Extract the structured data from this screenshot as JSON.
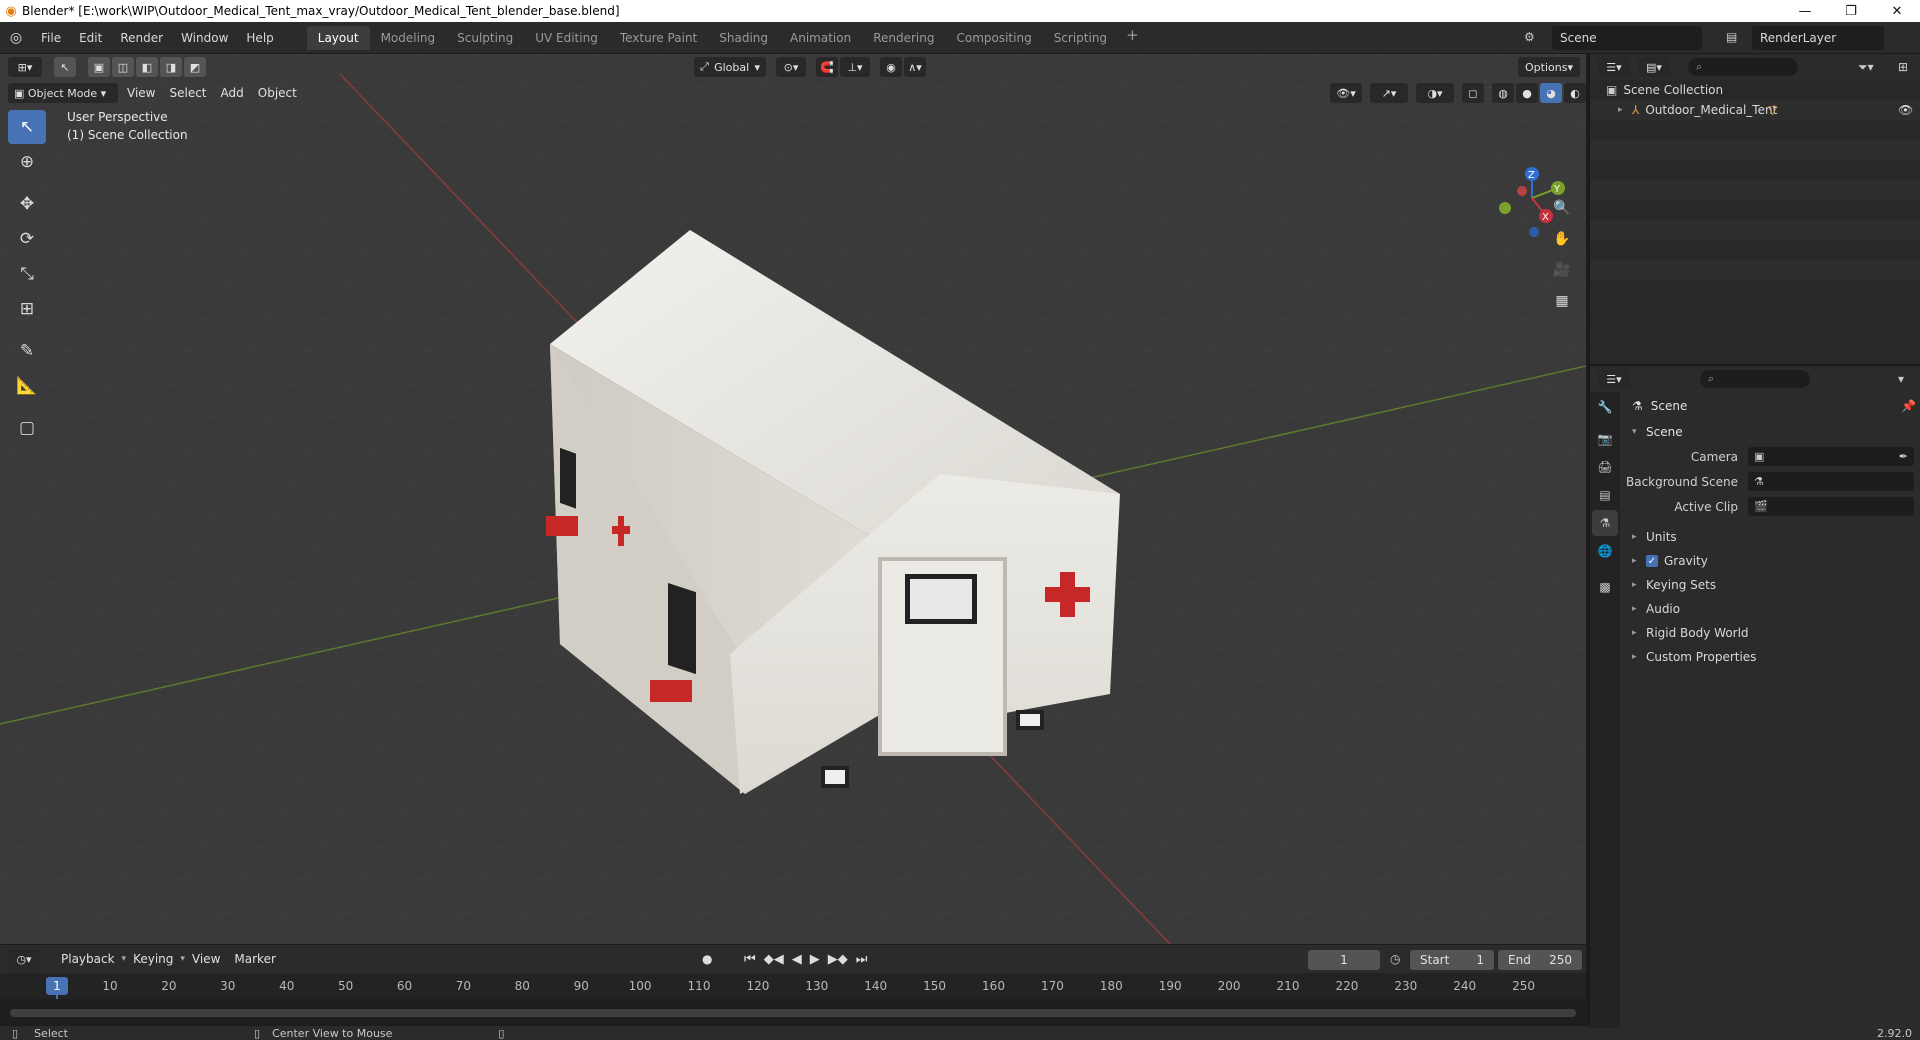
{
  "window": {
    "title": "Blender* [E:\\work\\WIP\\Outdoor_Medical_Tent_max_vray/Outdoor_Medical_Tent_blender_base.blend]",
    "minimize": "—",
    "maximize": "❐",
    "close": "✕"
  },
  "menu": [
    "File",
    "Edit",
    "Render",
    "Window",
    "Help"
  ],
  "workspaces": [
    "Layout",
    "Modeling",
    "Sculpting",
    "UV Editing",
    "Texture Paint",
    "Shading",
    "Animation",
    "Rendering",
    "Compositing",
    "Scripting"
  ],
  "active_workspace": "Layout",
  "scene_name": "Scene",
  "render_layer": "RenderLayer",
  "viewport": {
    "transform_orientation": "Global",
    "options_label": "Options",
    "mode": "Object Mode",
    "menus": [
      "View",
      "Select",
      "Add",
      "Object"
    ],
    "perspective_label": "User Perspective",
    "collection_label": "(1) Scene Collection",
    "axis_x": "X",
    "axis_y": "Y",
    "axis_z": "Z"
  },
  "outliner": {
    "root": "Scene Collection",
    "items": [
      {
        "name": "Outdoor_Medical_Tent"
      }
    ]
  },
  "properties": {
    "context": "Scene",
    "panel": "Scene",
    "fields": [
      {
        "label": "Camera",
        "value": ""
      },
      {
        "label": "Background Scene",
        "value": ""
      },
      {
        "label": "Active Clip",
        "value": ""
      }
    ],
    "sections": [
      {
        "label": "Units",
        "checkbox": false
      },
      {
        "label": "Gravity",
        "checkbox": true
      },
      {
        "label": "Keying Sets",
        "checkbox": false
      },
      {
        "label": "Audio",
        "checkbox": false
      },
      {
        "label": "Rigid Body World",
        "checkbox": false
      },
      {
        "label": "Custom Properties",
        "checkbox": false
      }
    ]
  },
  "timeline": {
    "menus": [
      "Playback",
      "Keying",
      "View",
      "Marker"
    ],
    "current_frame": "1",
    "start_label": "Start",
    "start": "1",
    "end_label": "End",
    "end": "250",
    "ticks": [
      "1",
      "10",
      "20",
      "30",
      "40",
      "50",
      "60",
      "70",
      "80",
      "90",
      "100",
      "110",
      "120",
      "130",
      "140",
      "150",
      "160",
      "170",
      "180",
      "190",
      "200",
      "210",
      "220",
      "230",
      "240",
      "250"
    ]
  },
  "status": {
    "left": "Select",
    "middle": "Center View to Mouse",
    "version": "2.92.0"
  }
}
